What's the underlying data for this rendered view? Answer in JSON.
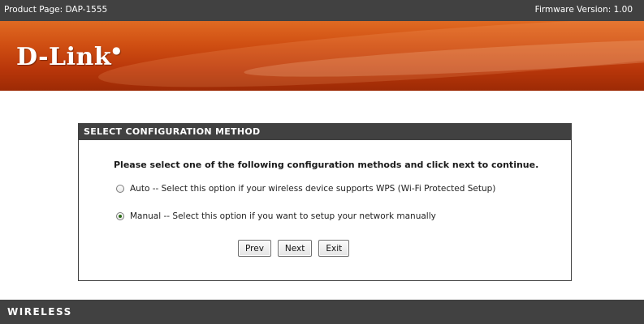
{
  "header": {
    "product_page": "Product Page: DAP-1555",
    "firmware_version": "Firmware Version: 1.00"
  },
  "banner": {
    "logo_text": "D-Link"
  },
  "panel": {
    "title": "SELECT CONFIGURATION METHOD",
    "instruction": "Please select one of the following configuration methods and click next to continue.",
    "options": [
      {
        "label": "Auto -- Select this option if your wireless device supports WPS (Wi-Fi Protected Setup)",
        "selected": false
      },
      {
        "label": "Manual -- Select this option if you want to setup your network manually",
        "selected": true
      }
    ],
    "buttons": {
      "prev": "Prev",
      "next": "Next",
      "exit": "Exit"
    }
  },
  "footer": {
    "label": "WIRELESS"
  },
  "colors": {
    "dark_bar": "#414141",
    "brand_orange": "#cf4e12"
  }
}
